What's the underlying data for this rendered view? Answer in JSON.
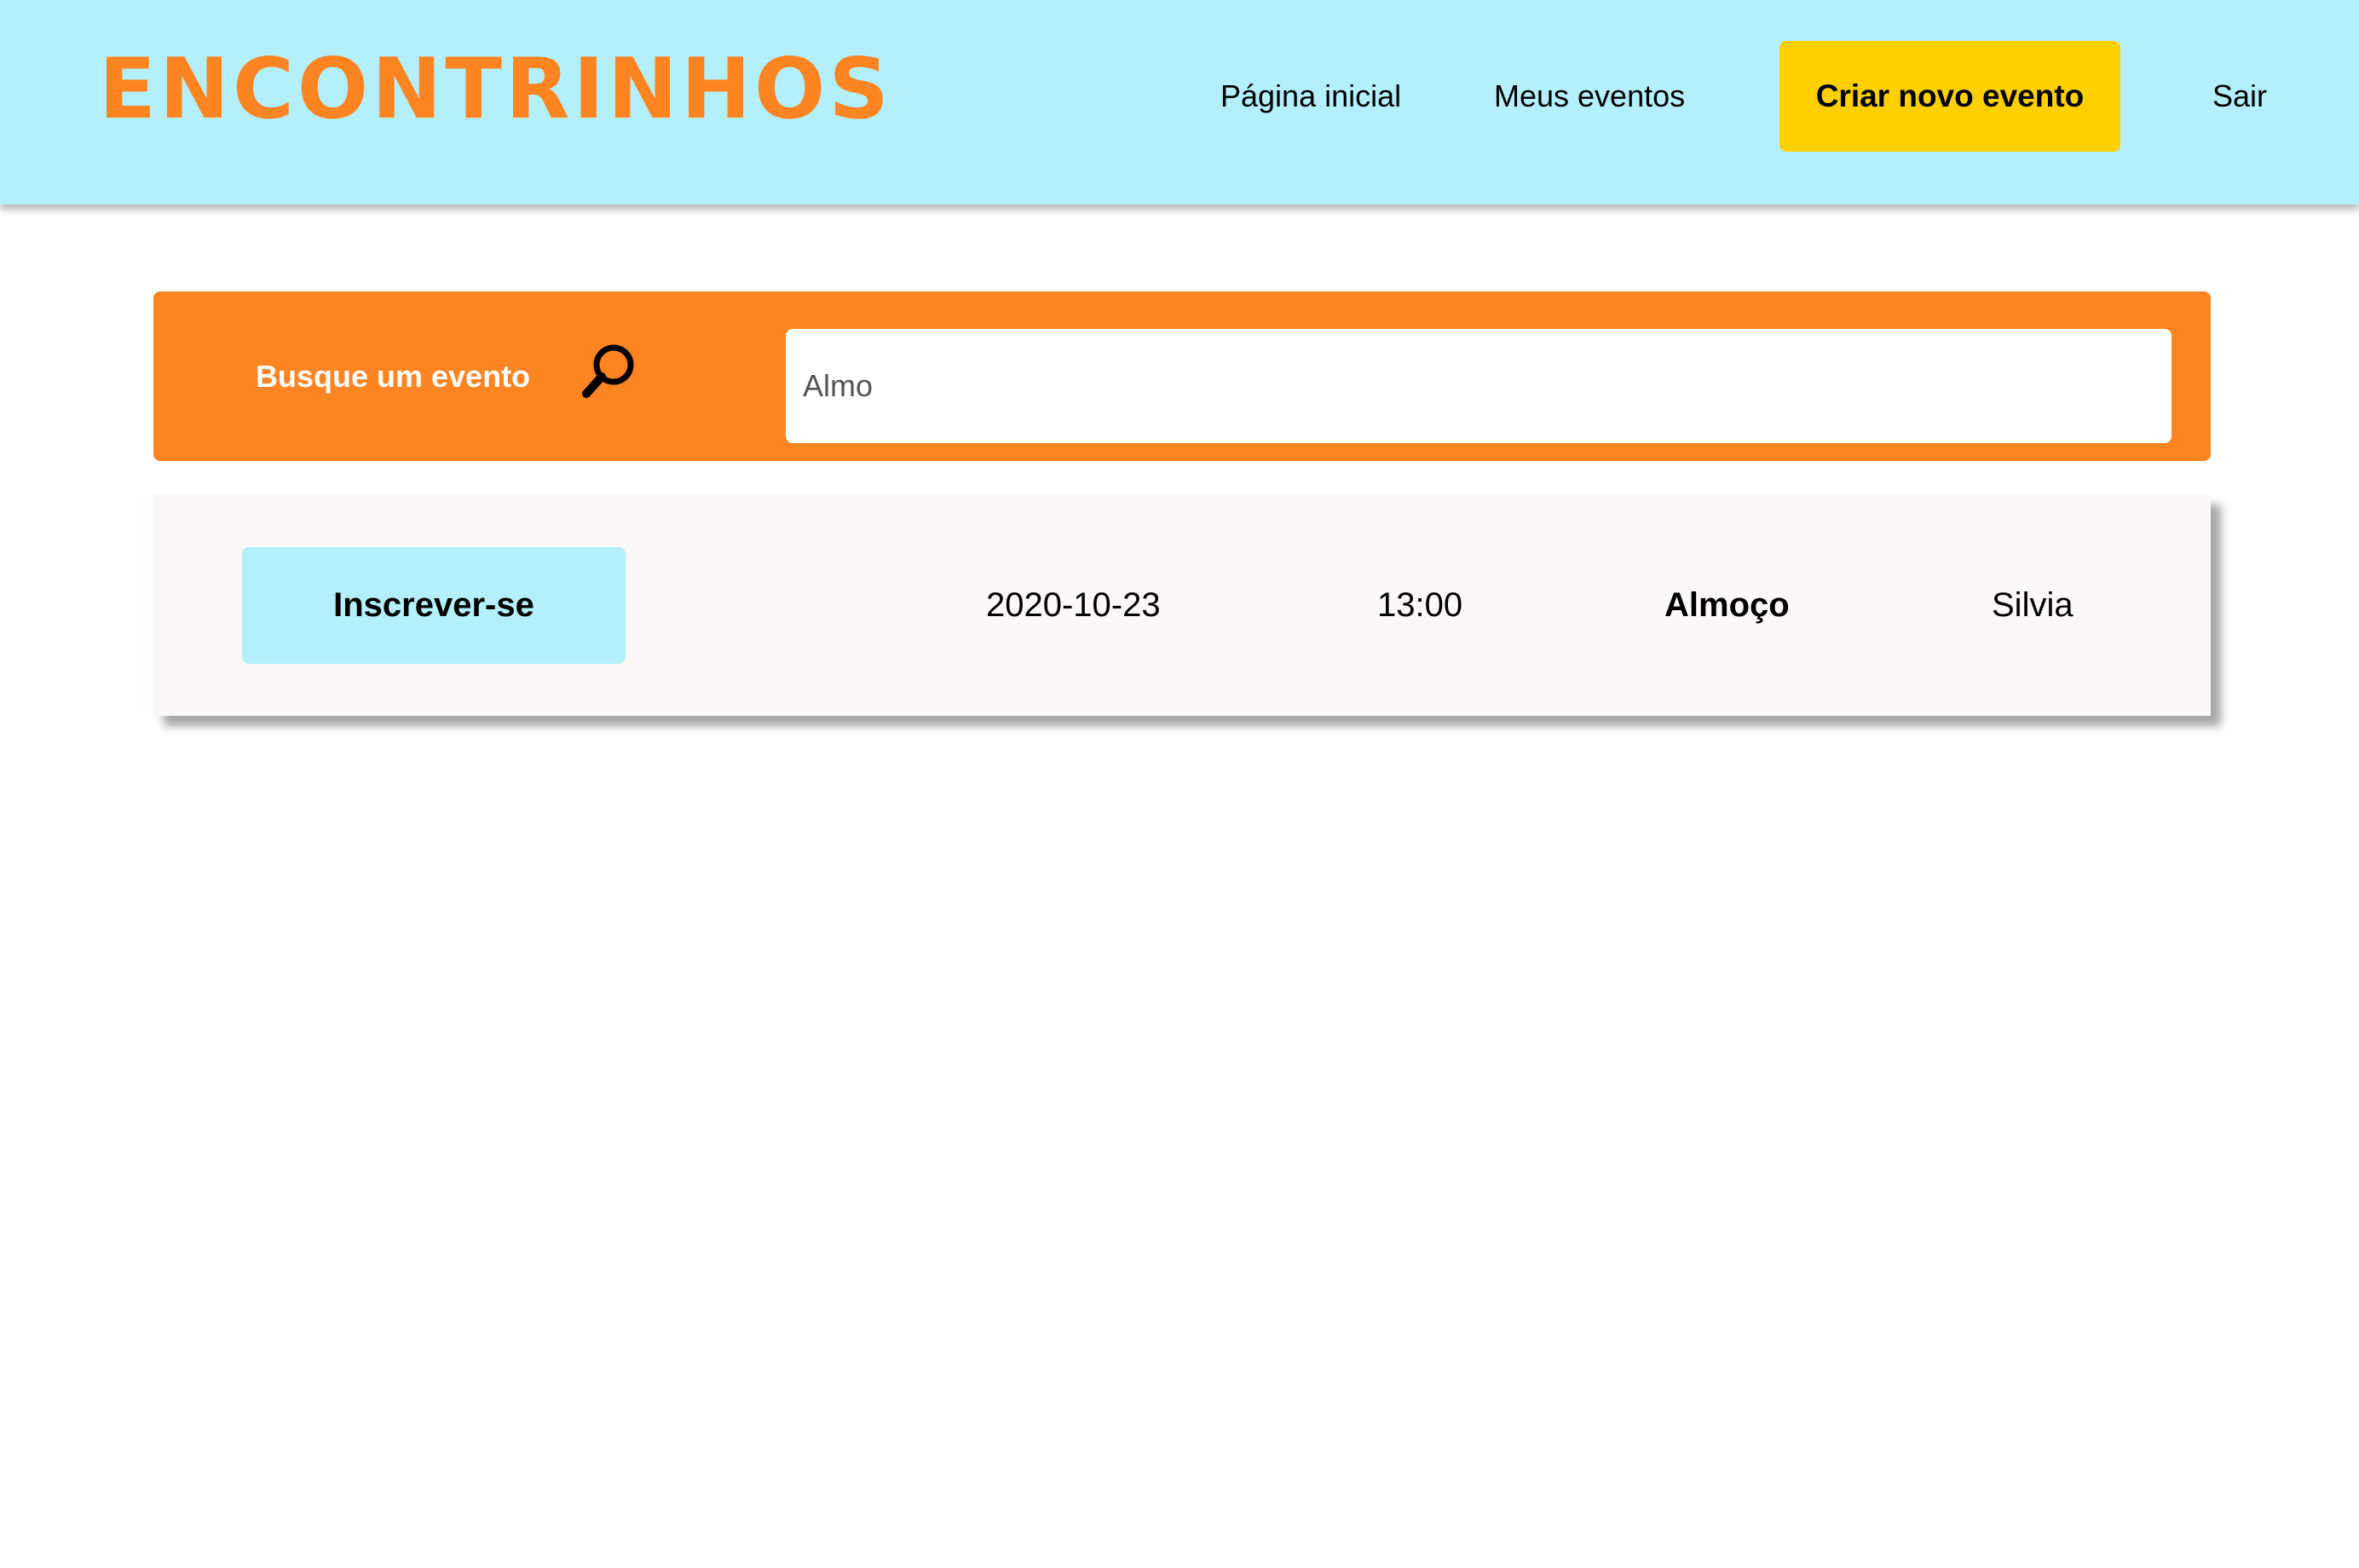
{
  "header": {
    "logo": "ENCONTRINHOS",
    "nav": {
      "home": "Página inicial",
      "my_events": "Meus eventos",
      "create_event": "Criar novo evento",
      "logout": "Sair"
    }
  },
  "search": {
    "label": "Busque um evento",
    "icon": "search-icon",
    "value": "Almo"
  },
  "results": [
    {
      "action": "Inscrever-se",
      "date": "2020-10-23",
      "time": "13:00",
      "name": "Almoço",
      "owner": "Silvia"
    }
  ],
  "colors": {
    "header_bg": "#b3f0fc",
    "brand_orange": "#ff8422",
    "create_button": "#ffd000",
    "subscribe_button": "#b3f0fc",
    "row_bg": "#fcf8f7"
  }
}
